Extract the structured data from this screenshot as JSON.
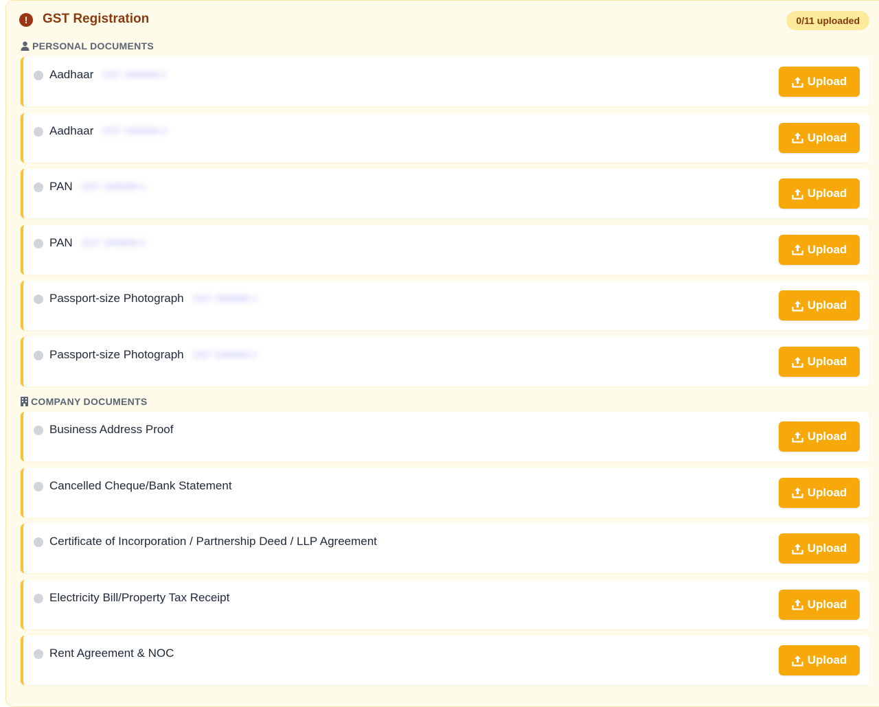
{
  "header": {
    "title": "GST Registration",
    "status_badge": "0/11 uploaded",
    "alert_icon": "exclamation-circle-icon",
    "alert_glyph": "!"
  },
  "sections": {
    "personal": {
      "label": "PERSONAL DOCUMENTS",
      "icon": "user-icon",
      "items": [
        {
          "name": "Aadhaar",
          "redacted_detail": "1027 1666666-1"
        },
        {
          "name": "Aadhaar",
          "redacted_detail": "1027 1666666-2"
        },
        {
          "name": "PAN",
          "redacted_detail": "1027 1666666-1"
        },
        {
          "name": "PAN",
          "redacted_detail": "1027 1666666-2"
        },
        {
          "name": "Passport-size Photograph",
          "redacted_detail": "1027 1666666-1"
        },
        {
          "name": "Passport-size Photograph",
          "redacted_detail": "1027 1666666-2"
        }
      ]
    },
    "company": {
      "label": "COMPANY DOCUMENTS",
      "icon": "building-icon",
      "items": [
        {
          "name": "Business Address Proof"
        },
        {
          "name": "Cancelled Cheque/Bank Statement"
        },
        {
          "name": "Certificate of Incorporation / Partnership Deed / LLP Agreement"
        },
        {
          "name": "Electricity Bill/Property Tax Receipt"
        },
        {
          "name": "Rent Agreement & NOC"
        }
      ]
    }
  },
  "upload_button": {
    "label": "Upload",
    "icon": "upload-icon"
  },
  "colors": {
    "accent": "#f7a90c",
    "panel_bg": "#fefbea",
    "title": "#8a3a0f",
    "badge_bg": "#fdeb9b",
    "status_dot": "#d1d5db"
  }
}
